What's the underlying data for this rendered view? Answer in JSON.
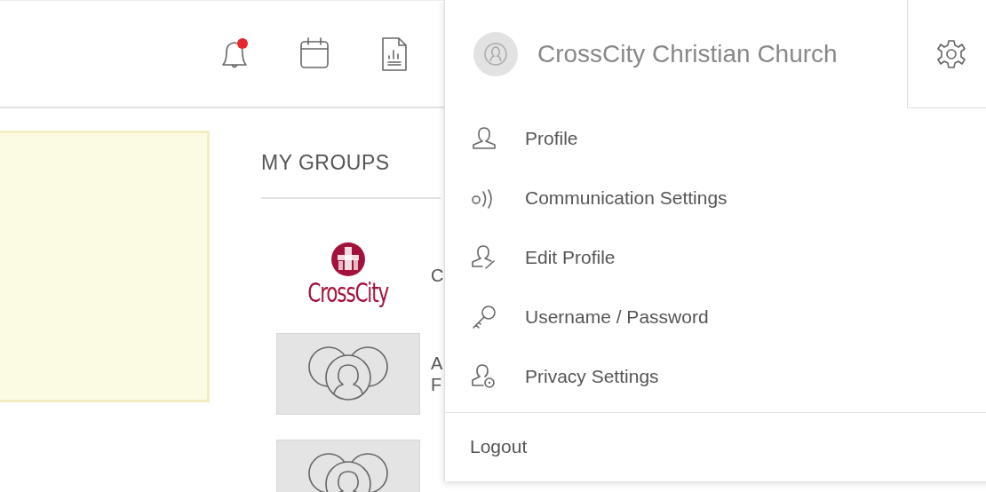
{
  "toolbar_icons": [
    {
      "kind": "bell",
      "alert": true
    },
    {
      "kind": "calendar",
      "alert": false
    },
    {
      "kind": "report",
      "alert": false
    }
  ],
  "account_menu": {
    "name": "CrossCity Christian Church",
    "items": [
      {
        "kind": "profile",
        "label": "Profile"
      },
      {
        "kind": "communication",
        "label": "Communication Settings"
      },
      {
        "kind": "edit",
        "label": "Edit Profile"
      },
      {
        "kind": "key",
        "label": "Username / Password"
      },
      {
        "kind": "privacy",
        "label": "Privacy Settings"
      }
    ],
    "logout": "Logout"
  },
  "groups": {
    "title": "MY GROUPS",
    "items": [
      {
        "kind": "logo",
        "logo_text": "CrossCity",
        "name_lines": [
          "C"
        ]
      },
      {
        "kind": "avatar",
        "name_lines": [
          "A",
          "F"
        ]
      },
      {
        "kind": "avatar"
      }
    ]
  }
}
